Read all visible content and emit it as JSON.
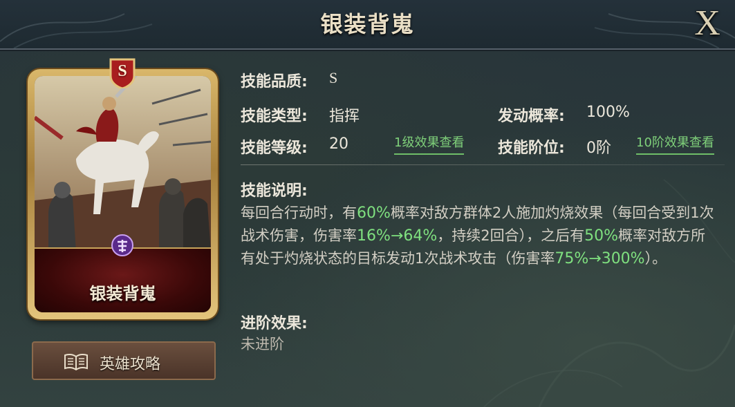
{
  "header": {
    "title": "银装背嵬",
    "close_label": "X"
  },
  "card": {
    "rank": "S",
    "name": "银装背嵬"
  },
  "guide_button": {
    "label": "英雄攻略",
    "icon": "book-icon"
  },
  "info": {
    "quality_label": "技能品质:",
    "quality_value": "S",
    "type_label": "技能类型:",
    "type_value": "指挥",
    "trigger_label": "发动概率:",
    "trigger_value": "100%",
    "level_label": "技能等级:",
    "level_value": "20",
    "level_link": "1级效果查看",
    "tier_label": "技能阶位:",
    "tier_value": "0阶",
    "tier_link": "10阶效果查看"
  },
  "description": {
    "label": "技能说明:",
    "segments": [
      {
        "text": "每回合行动时，有",
        "highlight": false
      },
      {
        "text": "60%",
        "highlight": true
      },
      {
        "text": "概率对敌方群体2人施加灼烧效果（每回合受到1次战术伤害，伤害率",
        "highlight": false
      },
      {
        "text": "16%→64%",
        "highlight": true
      },
      {
        "text": "，持续2回合），之后有",
        "highlight": false
      },
      {
        "text": "50%",
        "highlight": true
      },
      {
        "text": "概率对敌方所有处于灼烧状态的目标发动1次战术攻击（伤害率",
        "highlight": false
      },
      {
        "text": "75%→300%",
        "highlight": true
      },
      {
        "text": "）。",
        "highlight": false
      }
    ]
  },
  "advance": {
    "label": "进阶效果:",
    "value": "未进阶"
  },
  "colors": {
    "highlight": "#7fe07f",
    "link": "#7fd07a",
    "card_frame": "#d9b76a",
    "name_box": "#6a1818"
  }
}
